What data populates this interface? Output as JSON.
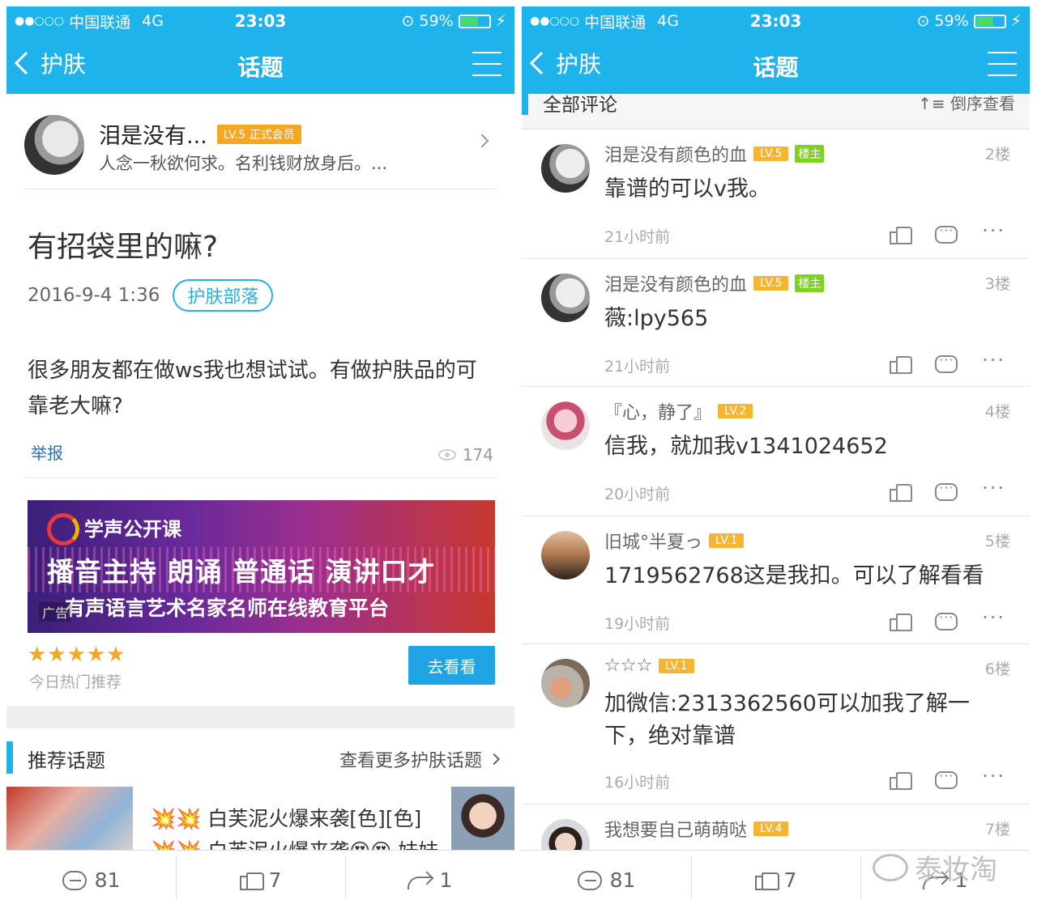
{
  "status": {
    "carrier": "中国联通",
    "network": "4G",
    "time": "23:03",
    "battery": "59%",
    "battery_level": 0.59
  },
  "left": {
    "nav": {
      "back_label": "护肤",
      "title": "话题"
    },
    "author": {
      "name": "泪是没有...",
      "level": "LV.5 正式会员",
      "signature": "人念一秋欲何求。名利钱财放身后。..."
    },
    "post": {
      "title": "有招袋里的嘛?",
      "date": "2016-9-4 1:36",
      "tag": "护肤部落",
      "body": "很多朋友都在做ws我也想试试。有做护肤品的可靠老大嘛?",
      "report": "举报",
      "views": "174"
    },
    "ad": {
      "line1": "学声公开课",
      "line2": "播音主持 朗诵 普通话 演讲口才",
      "line3": "有声语言艺术名家名师在线教育平台",
      "tag": "广告",
      "stars": "★★★★★",
      "sub": "今日热门推荐",
      "button": "去看看"
    },
    "recommend": {
      "title": "推荐话题",
      "more": "查看更多护肤话题",
      "item_line1": "💥💥 白芙泥火爆来袭[色][色]",
      "item_line2": "💥💥 白芙泥火爆来袭😍😍 妹妹"
    },
    "bottom": {
      "comments": "81",
      "likes": "7",
      "shares": "1"
    }
  },
  "right": {
    "nav": {
      "back_label": "护肤",
      "title": "话题"
    },
    "section": {
      "title": "全部评论",
      "sort": "↑≡ 倒序查看"
    },
    "comments": [
      {
        "name": "泪是没有颜色的血",
        "level": "LV.5",
        "owner": "楼主",
        "floor": "2楼",
        "text": "靠谱的可以v我。",
        "time": "21小时前"
      },
      {
        "name": "泪是没有颜色的血",
        "level": "LV.5",
        "owner": "楼主",
        "floor": "3楼",
        "text": "薇:lpy565",
        "time": "21小时前"
      },
      {
        "name": "『心，静了』",
        "level": "LV.2",
        "floor": "4楼",
        "text": "信我，就加我v1341024652",
        "time": "20小时前"
      },
      {
        "name": "旧城°半夏っ",
        "level": "LV.1",
        "floor": "5楼",
        "text": "1719562768这是我扣。可以了解看看",
        "time": "19小时前"
      },
      {
        "name": "☆☆☆",
        "level": "LV.1",
        "floor": "6楼",
        "text": "加微信:2313362560可以加我了解一下，绝对靠谱",
        "time": "16小时前"
      },
      {
        "name": "我想要自己萌萌哒",
        "level": "LV.4",
        "floor": "7楼"
      }
    ],
    "bottom": {
      "comments": "81",
      "likes": "7",
      "shares": "1"
    },
    "watermark": "泰妆淘"
  }
}
